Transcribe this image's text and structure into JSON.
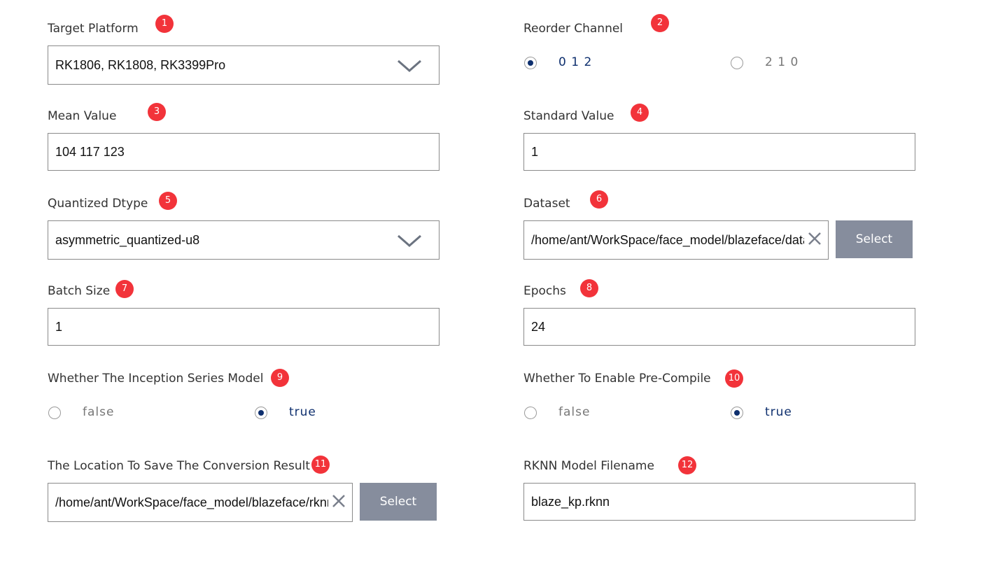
{
  "target_platform": {
    "label": "Target Platform",
    "badge": "1",
    "value": "RK1806, RK1808, RK3399Pro",
    "icon": "chevron-down-icon"
  },
  "reorder_channel": {
    "label": "Reorder Channel",
    "badge": "2",
    "options": [
      "0 1 2",
      "2 1 0"
    ],
    "selected": "0 1 2"
  },
  "mean_value": {
    "label": "Mean Value",
    "badge": "3",
    "value": "104 117 123"
  },
  "standard_value": {
    "label": "Standard Value",
    "badge": "4",
    "value": "1"
  },
  "quantized_dtype": {
    "label": "Quantized Dtype",
    "badge": "5",
    "value": "asymmetric_quantized-u8",
    "icon": "chevron-down-icon"
  },
  "dataset": {
    "label": "Dataset",
    "badge": "6",
    "value": "/home/ant/WorkSpace/face_model/blazeface/data",
    "select_label": "Select",
    "icon": "close-icon"
  },
  "batch_size": {
    "label": "Batch Size",
    "badge": "7",
    "value": "1"
  },
  "epochs": {
    "label": "Epochs",
    "badge": "8",
    "value": "24"
  },
  "inception": {
    "label": "Whether The Inception Series Model",
    "badge": "9",
    "options": [
      "false",
      "true"
    ],
    "selected": "true"
  },
  "precompile": {
    "label": "Whether To Enable Pre-Compile",
    "badge": "10",
    "options": [
      "false",
      "true"
    ],
    "selected": "true"
  },
  "save_location": {
    "label": "The Location To Save The Conversion Result",
    "badge": "11",
    "value": "/home/ant/WorkSpace/face_model/blazeface/rknn",
    "select_label": "Select",
    "icon": "close-icon"
  },
  "rknn_filename": {
    "label": "RKNN Model Filename",
    "badge": "12",
    "value": "blaze_kp.rknn"
  },
  "colors": {
    "badge": "#f2333a",
    "accent": "#0e2f6e",
    "button": "#868d9d",
    "border": "#8a8a8a"
  }
}
